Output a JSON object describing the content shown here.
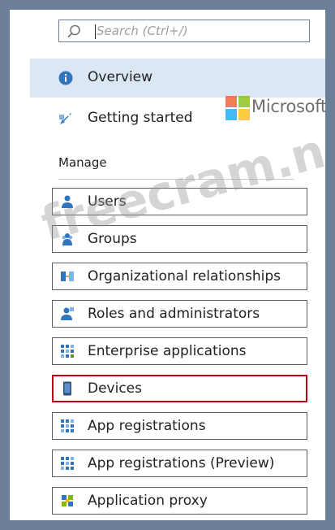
{
  "search": {
    "placeholder": "Search (Ctrl+/)"
  },
  "nav": {
    "overview": {
      "label": "Overview"
    },
    "getting_started": {
      "label": "Getting started"
    }
  },
  "section": {
    "title": "Manage"
  },
  "manage_items": [
    {
      "label": "Users",
      "icon": "user-icon"
    },
    {
      "label": "Groups",
      "icon": "group-icon"
    },
    {
      "label": "Organizational relationships",
      "icon": "org-relationships-icon"
    },
    {
      "label": "Roles and administrators",
      "icon": "roles-icon"
    },
    {
      "label": "Enterprise applications",
      "icon": "enterprise-apps-icon"
    },
    {
      "label": "Devices",
      "icon": "device-icon",
      "selected": true
    },
    {
      "label": "App registrations",
      "icon": "app-registrations-icon"
    },
    {
      "label": "App registrations (Preview)",
      "icon": "app-registrations-icon"
    },
    {
      "label": "Application proxy",
      "icon": "app-proxy-icon"
    }
  ],
  "brand": {
    "text": "Microsoft"
  },
  "watermark": {
    "text": "freecram.net"
  },
  "colors": {
    "highlight": "#dbe7f3",
    "selected_border": "#c40012",
    "icon_blue": "#2f75c0",
    "ms_red": "#f25022",
    "ms_green": "#7fba00",
    "ms_blue": "#00a4ef",
    "ms_yellow": "#ffb900"
  }
}
